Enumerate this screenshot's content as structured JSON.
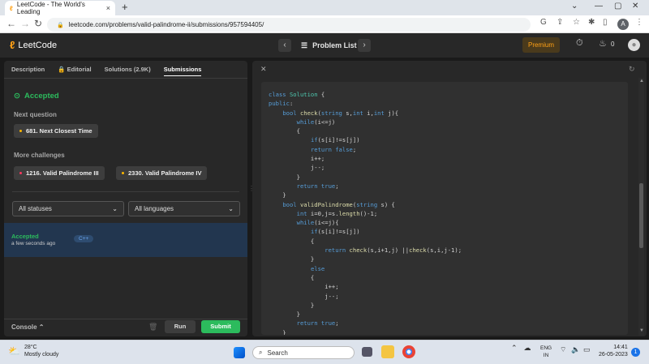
{
  "browser": {
    "tab_title": "LeetCode - The World's Leading",
    "tab_close": "×",
    "new_tab": "+",
    "url": "leetcode.com/problems/valid-palindrome-ii/submissions/957594405/",
    "profile_initial": "A"
  },
  "nav": {
    "logo": "LeetCode",
    "problem_list": "Problem List",
    "premium": "Premium",
    "streak_count": "0"
  },
  "left": {
    "tabs": [
      "Description",
      "Editorial",
      "Solutions (2.9K)",
      "Submissions"
    ],
    "status": "Accepted",
    "next_question_label": "Next question",
    "next_question": "681. Next Closest Time",
    "more_challenges_label": "More challenges",
    "challenges": [
      "1216. Valid Palindrome III",
      "2330. Valid Palindrome IV"
    ],
    "filter_status": "All statuses",
    "filter_language": "All languages",
    "submission": {
      "status": "Accepted",
      "time": "a few seconds ago",
      "language": "C++"
    },
    "console": "Console",
    "run": "Run",
    "submit": "Submit"
  },
  "code_lines": [
    "class Solution {",
    "public:",
    "    bool check(string s,int i,int j){",
    "        while(i<=j)",
    "        {",
    "            if(s[i]!=s[j])",
    "            return false;",
    "            i++;",
    "            j--;",
    "        }",
    "        return true;",
    "    }",
    "    bool validPalindrome(string s) {",
    "        int i=0,j=s.length()-1;",
    "        while(i<=j){",
    "            if(s[i]!=s[j])",
    "            {",
    "                return check(s,i+1,j) ||check(s,i,j-1);",
    "            }",
    "            else",
    "            {",
    "                i++;",
    "                j--;",
    "            }",
    "        }",
    "        return true;",
    "    }"
  ],
  "taskbar": {
    "temp": "28°C",
    "weather": "Mostly cloudy",
    "search": "Search",
    "lang1": "ENG",
    "lang2": "IN",
    "time": "14:41",
    "date": "26-05-2023",
    "notif": "1"
  },
  "colors": {
    "accent": "#ffa116",
    "success": "#2cbb5d",
    "panel": "#282828"
  }
}
